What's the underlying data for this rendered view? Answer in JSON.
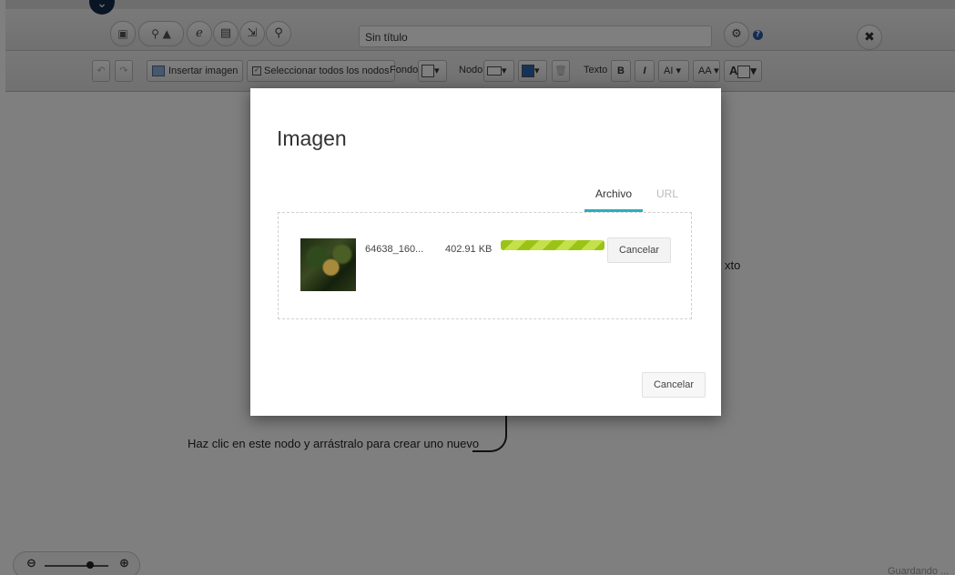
{
  "header": {
    "document_title": "Sin título",
    "toolbar_icons": [
      "save-icon",
      "share-icon",
      "publish-icon",
      "tag-icon",
      "image-icon",
      "export-icon",
      "search-icon"
    ]
  },
  "toolbar": {
    "insert_image": "Insertar imagen",
    "select_all_nodes": "Seleccionar todos los nodos",
    "background_label": "Fondo",
    "node_label": "Nodo",
    "text_label": "Texto",
    "bold": "B",
    "italic": "I",
    "font_size": "AI",
    "font_case": "AA",
    "font_color": "A"
  },
  "canvas": {
    "hint": "Haz clic en este nodo y arrástralo para crear uno nuevo",
    "behind_text": "xto"
  },
  "footer": {
    "saving": "Guardando ..."
  },
  "modal": {
    "title": "Imagen",
    "tabs": [
      {
        "label": "Archivo",
        "active": true
      },
      {
        "label": "URL",
        "active": false
      }
    ],
    "file": {
      "name": "64638_160...",
      "size": "402.91 KB",
      "progress": 1.0,
      "cancel_label": "Cancelar"
    },
    "cancel_label": "Cancelar"
  },
  "colors": {
    "accent": "#2aaec0",
    "progress": "#9bc316",
    "badge": "#13294b",
    "help": "#2a5aa6"
  }
}
